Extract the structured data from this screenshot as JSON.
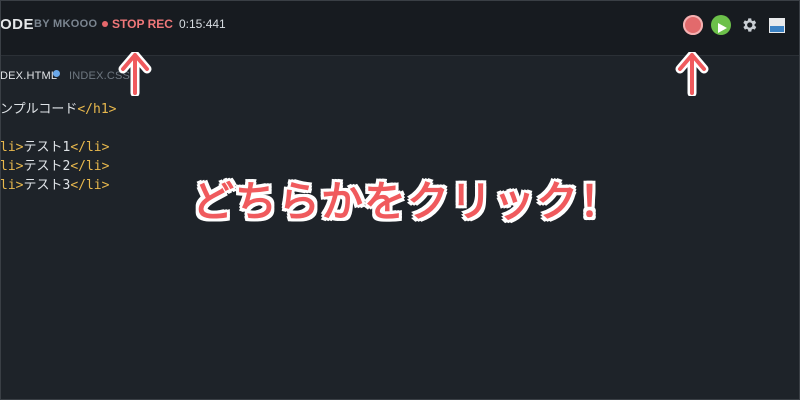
{
  "header": {
    "app_title": "ODE",
    "app_author": "BY MKOOO",
    "stop_rec_label": "STOP REC",
    "timer": "0:15:441"
  },
  "toolbar": {
    "record_icon": "record-icon",
    "play_icon": "play-icon",
    "settings_icon": "gear-icon",
    "layout_icon": "layout-icon",
    "more_icon": "more-icon"
  },
  "tabs": [
    {
      "label": "DEX.HTML",
      "active": true,
      "modified": true
    },
    {
      "label": "INDEX.CSS",
      "active": false
    }
  ],
  "code": {
    "lines": [
      {
        "tag_open": "",
        "text": "ンプルコード",
        "tag_close": "</h1>"
      },
      {
        "tag_open": "",
        "text": "",
        "tag_close": ""
      },
      {
        "tag_open": "li>",
        "text": "テスト1",
        "tag_close": "</li>"
      },
      {
        "tag_open": "li>",
        "text": "テスト2",
        "tag_close": "</li>"
      },
      {
        "tag_open": "li>",
        "text": "テスト3",
        "tag_close": "</li>"
      }
    ]
  },
  "annotation": {
    "call_to_action": "どちらかをクリック！",
    "arrow_color": "#f05a5d"
  },
  "colors": {
    "background": "#1e2329",
    "header": "#171b20",
    "record_red": "#e26a6c",
    "play_green": "#6cc04a",
    "tag_yellow": "#e8b84d"
  }
}
